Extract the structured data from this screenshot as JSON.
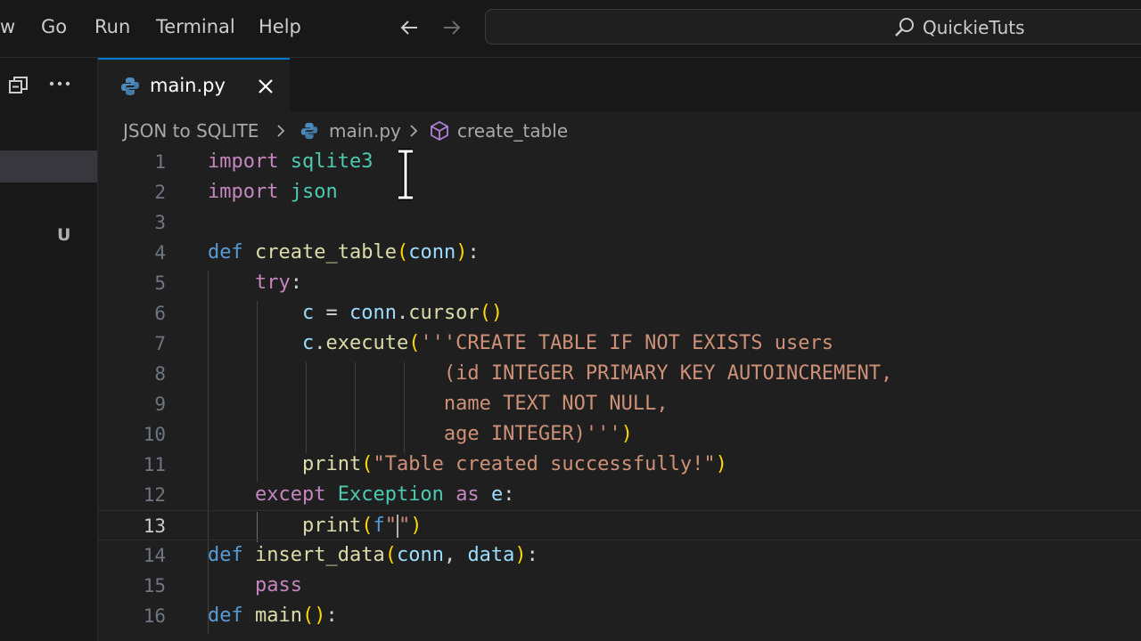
{
  "menu": {
    "items": [
      "w",
      "Go",
      "Run",
      "Terminal",
      "Help"
    ]
  },
  "command_center": {
    "text": "QuickieTuts"
  },
  "sidebar": {
    "badge": "U"
  },
  "tab": {
    "label": "main.py"
  },
  "breadcrumb": {
    "folder": "JSON to SQLITE",
    "file": "main.py",
    "symbol": "create_table"
  },
  "editor": {
    "line_numbers": [
      "1",
      "2",
      "3",
      "4",
      "5",
      "6",
      "7",
      "8",
      "9",
      "10",
      "11",
      "12",
      "13",
      "14",
      "15",
      "16"
    ],
    "active_line": "13",
    "lines": [
      [
        [
          "kw",
          "import"
        ],
        [
          "plain",
          " "
        ],
        [
          "mod",
          "sqlite3"
        ]
      ],
      [
        [
          "kw",
          "import"
        ],
        [
          "plain",
          " "
        ],
        [
          "mod",
          "json"
        ]
      ],
      [],
      [
        [
          "def",
          "def"
        ],
        [
          "plain",
          " "
        ],
        [
          "fn",
          "create_table"
        ],
        [
          "br1",
          "("
        ],
        [
          "var",
          "conn"
        ],
        [
          "br1",
          ")"
        ],
        [
          "plain",
          ":"
        ]
      ],
      [
        [
          "plain",
          "    "
        ],
        [
          "kw",
          "try"
        ],
        [
          "plain",
          ":"
        ]
      ],
      [
        [
          "plain",
          "        "
        ],
        [
          "var",
          "c"
        ],
        [
          "plain",
          " = "
        ],
        [
          "var",
          "conn"
        ],
        [
          "plain",
          "."
        ],
        [
          "fn",
          "cursor"
        ],
        [
          "br1",
          "()"
        ]
      ],
      [
        [
          "plain",
          "        "
        ],
        [
          "var",
          "c"
        ],
        [
          "plain",
          "."
        ],
        [
          "fn",
          "execute"
        ],
        [
          "br1",
          "("
        ],
        [
          "str",
          "'''CREATE TABLE IF NOT EXISTS users"
        ]
      ],
      [
        [
          "str",
          "                    (id INTEGER PRIMARY KEY AUTOINCREMENT,"
        ]
      ],
      [
        [
          "str",
          "                    name TEXT NOT NULL,"
        ]
      ],
      [
        [
          "str",
          "                    age INTEGER)'''"
        ],
        [
          "br1",
          ")"
        ]
      ],
      [
        [
          "plain",
          "        "
        ],
        [
          "fn",
          "print"
        ],
        [
          "br1",
          "("
        ],
        [
          "str",
          "\"Table created successfully!\""
        ],
        [
          "br1",
          ")"
        ]
      ],
      [
        [
          "plain",
          "    "
        ],
        [
          "kw",
          "except"
        ],
        [
          "plain",
          " "
        ],
        [
          "mod",
          "Exception"
        ],
        [
          "plain",
          " "
        ],
        [
          "kw",
          "as"
        ],
        [
          "plain",
          " "
        ],
        [
          "var",
          "e"
        ],
        [
          "plain",
          ":"
        ]
      ],
      [
        [
          "plain",
          "        "
        ],
        [
          "fn",
          "print"
        ],
        [
          "br1",
          "("
        ],
        [
          "def",
          "f"
        ],
        [
          "str",
          "\""
        ],
        [
          "caret",
          ""
        ],
        [
          "str",
          "\""
        ],
        [
          "br1",
          ")"
        ]
      ],
      [
        [
          "def",
          "def"
        ],
        [
          "plain",
          " "
        ],
        [
          "fn",
          "insert_data"
        ],
        [
          "br1",
          "("
        ],
        [
          "var",
          "conn"
        ],
        [
          "plain",
          ", "
        ],
        [
          "var",
          "data"
        ],
        [
          "br1",
          ")"
        ],
        [
          "plain",
          ":"
        ]
      ],
      [
        [
          "plain",
          "    "
        ],
        [
          "kw",
          "pass"
        ]
      ],
      [
        [
          "def",
          "def"
        ],
        [
          "plain",
          " "
        ],
        [
          "fn",
          "main"
        ],
        [
          "br1",
          "()"
        ],
        [
          "plain",
          ":"
        ]
      ]
    ]
  },
  "colors": {
    "accent": "#0078d4",
    "keyword": "#c586c0",
    "storage": "#569cd6",
    "type": "#4ec9b0",
    "function": "#dcdcaa",
    "variable": "#9cdcfe",
    "string": "#ce9178"
  }
}
